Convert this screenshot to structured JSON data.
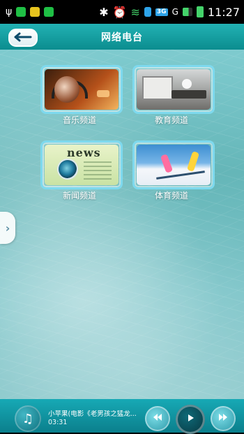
{
  "status_bar": {
    "usb_symbol": "ψ",
    "bluetooth_symbol": "✱",
    "alarm_symbol": "⏰",
    "wifi_symbol": "≋",
    "network_badge": "3G",
    "network_letter": "G",
    "time": "11:27",
    "icons": [
      "usb-icon",
      "app-icon-green",
      "app-icon-yellow",
      "app-icon-green-2",
      "bluetooth-icon",
      "alarm-icon",
      "wifi-icon",
      "sim-icon",
      "network-3g-icon",
      "signal-icon",
      "battery-icon"
    ]
  },
  "header": {
    "title": "网络电台",
    "back_icon": "back-arrow-icon"
  },
  "channels": [
    {
      "label": "音乐频道",
      "icon": "music-channel-thumbnail"
    },
    {
      "label": "教育频道",
      "icon": "education-channel-thumbnail"
    },
    {
      "label": "新闻频道",
      "icon": "news-channel-thumbnail",
      "overlay_text": "news"
    },
    {
      "label": "体育频道",
      "icon": "sports-channel-thumbnail"
    }
  ],
  "side_handle": {
    "symbol": "›"
  },
  "player": {
    "track_title": "小苹果(电影《老男孩之猛龙...",
    "time": "03:31",
    "music_note": "♫",
    "icons": [
      "music-note-icon",
      "rewind-icon",
      "play-icon",
      "fast-forward-icon"
    ]
  },
  "colors": {
    "header_teal": "#0b8d8f",
    "tile_border": "#7ed9ee",
    "player_teal": "#0b7f8c"
  }
}
